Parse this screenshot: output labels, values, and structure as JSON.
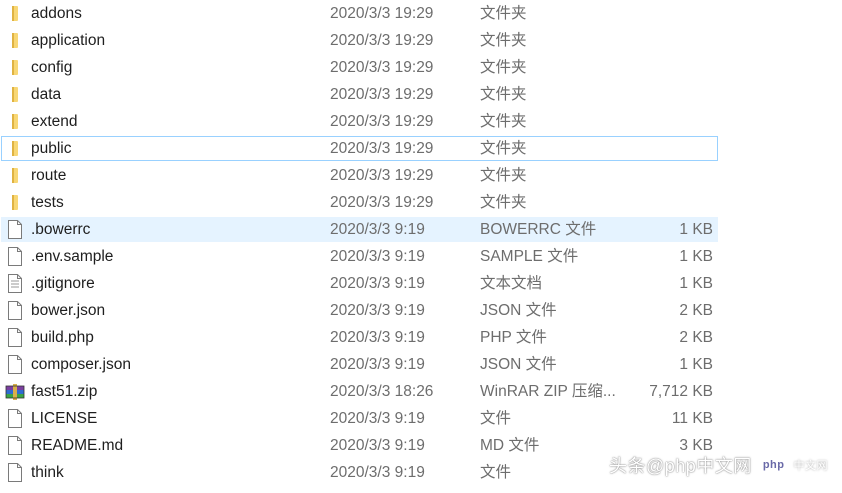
{
  "files": [
    {
      "name": "addons",
      "date": "2020/3/3 19:29",
      "type": "文件夹",
      "size": "",
      "icon": "folder-icon"
    },
    {
      "name": "application",
      "date": "2020/3/3 19:29",
      "type": "文件夹",
      "size": "",
      "icon": "folder-icon"
    },
    {
      "name": "config",
      "date": "2020/3/3 19:29",
      "type": "文件夹",
      "size": "",
      "icon": "folder-icon"
    },
    {
      "name": "data",
      "date": "2020/3/3 19:29",
      "type": "文件夹",
      "size": "",
      "icon": "folder-icon"
    },
    {
      "name": "extend",
      "date": "2020/3/3 19:29",
      "type": "文件夹",
      "size": "",
      "icon": "folder-icon"
    },
    {
      "name": "public",
      "date": "2020/3/3 19:29",
      "type": "文件夹",
      "size": "",
      "icon": "folder-icon",
      "state": "hover"
    },
    {
      "name": "route",
      "date": "2020/3/3 19:29",
      "type": "文件夹",
      "size": "",
      "icon": "folder-icon"
    },
    {
      "name": "tests",
      "date": "2020/3/3 19:29",
      "type": "文件夹",
      "size": "",
      "icon": "folder-icon"
    },
    {
      "name": ".bowerrc",
      "date": "2020/3/3 9:19",
      "type": "BOWERRC 文件",
      "size": "1 KB",
      "icon": "file-icon",
      "state": "selected"
    },
    {
      "name": ".env.sample",
      "date": "2020/3/3 9:19",
      "type": "SAMPLE 文件",
      "size": "1 KB",
      "icon": "file-icon"
    },
    {
      "name": ".gitignore",
      "date": "2020/3/3 9:19",
      "type": "文本文档",
      "size": "1 KB",
      "icon": "text-document-icon"
    },
    {
      "name": "bower.json",
      "date": "2020/3/3 9:19",
      "type": "JSON 文件",
      "size": "2 KB",
      "icon": "file-icon"
    },
    {
      "name": "build.php",
      "date": "2020/3/3 9:19",
      "type": "PHP 文件",
      "size": "2 KB",
      "icon": "file-icon"
    },
    {
      "name": "composer.json",
      "date": "2020/3/3 9:19",
      "type": "JSON 文件",
      "size": "1 KB",
      "icon": "file-icon"
    },
    {
      "name": "fast51.zip",
      "date": "2020/3/3 18:26",
      "type": "WinRAR ZIP 压缩...",
      "size": "7,712 KB",
      "icon": "winrar-archive-icon"
    },
    {
      "name": "LICENSE",
      "date": "2020/3/3 9:19",
      "type": "文件",
      "size": "11 KB",
      "icon": "file-icon"
    },
    {
      "name": "README.md",
      "date": "2020/3/3 9:19",
      "type": "MD 文件",
      "size": "3 KB",
      "icon": "file-icon"
    },
    {
      "name": "think",
      "date": "2020/3/3 9:19",
      "type": "文件",
      "size": "",
      "icon": "file-icon"
    }
  ],
  "watermark": {
    "text": "头条@php中文网",
    "logo": "php",
    "small": "中文网"
  },
  "colors": {
    "folder": "#f8d775",
    "folder_dark": "#e0b342",
    "hover_border": "#99d1ff",
    "selected_bg": "#e5f3ff",
    "secondary_text": "#6d6d6d"
  }
}
